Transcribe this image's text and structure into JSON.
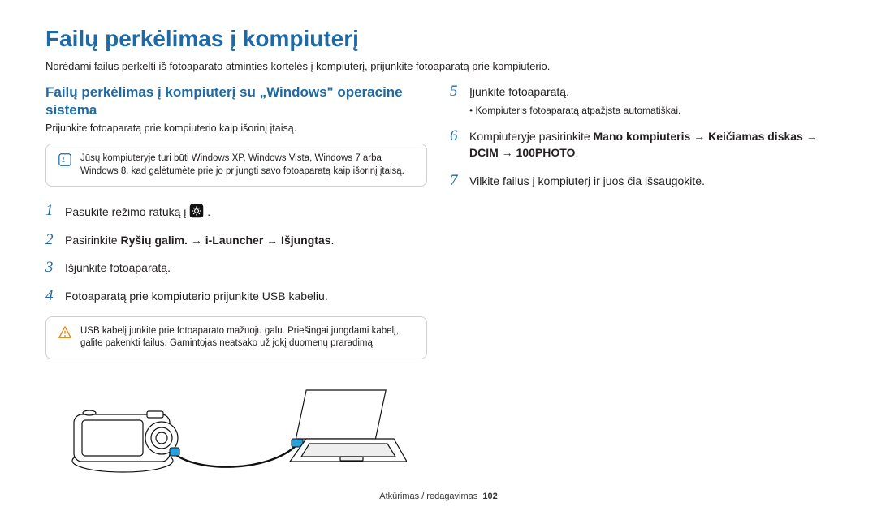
{
  "title": "Failų perkėlimas į kompiuterį",
  "subtitle": "Norėdami failus perkelti iš fotoaparato atminties kortelės į kompiuterį, prijunkite fotoaparatą prie kompiuterio.",
  "left": {
    "heading": "Failų perkėlimas į kompiuterį su „Windows\" operacine sistema",
    "subtext": "Prijunkite fotoaparatą prie kompiuterio kaip išorinį įtaisą.",
    "note": "Jūsų kompiuteryje turi būti Windows XP, Windows Vista, Windows 7 arba Windows 8, kad galėtumėte prie jo prijungti savo fotoaparatą kaip išorinį įtaisą.",
    "steps": {
      "1": {
        "text_before": "Pasukite režimo ratuką į ",
        "text_after": "."
      },
      "2": {
        "prefix": "Pasirinkite ",
        "bold": "Ryšių galim. → i-Launcher → Išjungtas",
        "suffix": "."
      },
      "3": {
        "text": "Išjunkite fotoaparatą."
      },
      "4": {
        "text": "Fotoaparatą prie kompiuterio prijunkite USB kabeliu."
      }
    },
    "warn": "USB kabelį junkite prie fotoaparato mažuoju galu. Priešingai jungdami kabelį, galite pakenkti failus. Gamintojas neatsako už jokį duomenų praradimą."
  },
  "right": {
    "steps": {
      "5": {
        "text": "Įjunkite fotoaparatą.",
        "sub": "Kompiuteris fotoaparatą atpažįsta automatiškai."
      },
      "6": {
        "prefix": "Kompiuteryje pasirinkite ",
        "bold": "Mano kompiuteris → Keičiamas diskas → DCIM → 100PHOTO",
        "suffix": "."
      },
      "7": {
        "text": "Vilkite failus į kompiuterį ir juos čia išsaugokite."
      }
    }
  },
  "footer": {
    "section": "Atkūrimas / redagavimas",
    "page": "102"
  }
}
